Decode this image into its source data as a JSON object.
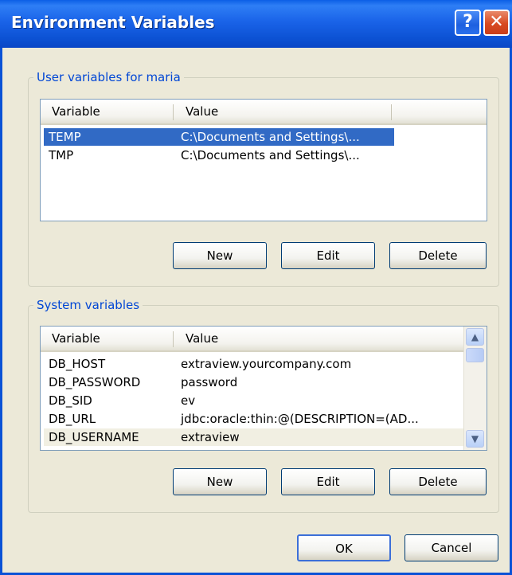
{
  "window": {
    "title": "Environment Variables",
    "help_glyph": "?",
    "close_glyph": "✕"
  },
  "user_vars": {
    "group_label": "User variables for maria",
    "columns": [
      "Variable",
      "Value"
    ],
    "rows": [
      {
        "variable": "TEMP",
        "value": "C:\\Documents and Settings\\...",
        "selected": true
      },
      {
        "variable": "TMP",
        "value": "C:\\Documents and Settings\\...",
        "selected": false
      }
    ],
    "buttons": {
      "new": "New",
      "edit": "Edit",
      "delete": "Delete"
    }
  },
  "system_vars": {
    "group_label": "System variables",
    "columns": [
      "Variable",
      "Value"
    ],
    "rows": [
      {
        "variable": "DB_HOST",
        "value": "extraview.yourcompany.com"
      },
      {
        "variable": "DB_PASSWORD",
        "value": "password"
      },
      {
        "variable": "DB_SID",
        "value": "ev"
      },
      {
        "variable": "DB_URL",
        "value": "jdbc:oracle:thin:@(DESCRIPTION=(AD..."
      },
      {
        "variable": "DB_USERNAME",
        "value": "extraview"
      }
    ],
    "buttons": {
      "new": "New",
      "edit": "Edit",
      "delete": "Delete"
    },
    "scroll_up_glyph": "▲",
    "scroll_down_glyph": "▼"
  },
  "dialog_buttons": {
    "ok": "OK",
    "cancel": "Cancel"
  },
  "colors": {
    "titlebar": "#0a52d6",
    "selection": "#316ac5",
    "group_label": "#0046d5",
    "face": "#ece9d8"
  }
}
